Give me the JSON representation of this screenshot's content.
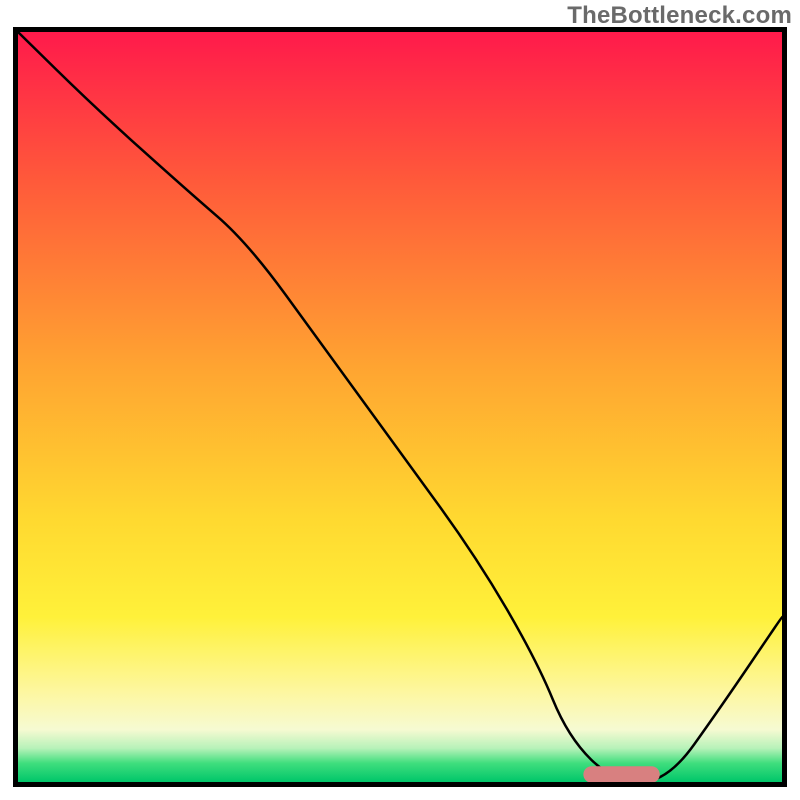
{
  "watermark": "TheBottleneck.com",
  "chart_data": {
    "type": "line",
    "title": "",
    "xlabel": "",
    "ylabel": "",
    "xlim": [
      0,
      100
    ],
    "ylim": [
      0,
      100
    ],
    "grid": false,
    "legend": false,
    "background": {
      "type": "vertical-gradient",
      "stops": [
        {
          "offset": 0.0,
          "color": "#ff1a4b"
        },
        {
          "offset": 0.2,
          "color": "#ff5a3a"
        },
        {
          "offset": 0.45,
          "color": "#ffa531"
        },
        {
          "offset": 0.65,
          "color": "#ffd930"
        },
        {
          "offset": 0.78,
          "color": "#fff13a"
        },
        {
          "offset": 0.88,
          "color": "#fdf7a0"
        },
        {
          "offset": 0.93,
          "color": "#f6fad2"
        },
        {
          "offset": 0.955,
          "color": "#b7f2b9"
        },
        {
          "offset": 0.975,
          "color": "#3fde7d"
        },
        {
          "offset": 1.0,
          "color": "#00c66a"
        }
      ]
    },
    "series": [
      {
        "name": "bottleneck-curve",
        "color": "#000000",
        "stroke_width": 2.5,
        "x": [
          0,
          10,
          22,
          30,
          40,
          50,
          60,
          68,
          72,
          78,
          85,
          92,
          100
        ],
        "y": [
          100,
          90,
          79,
          72,
          58,
          44,
          30,
          16,
          6,
          0,
          0,
          10,
          22
        ]
      }
    ],
    "marker": {
      "name": "optimal-range",
      "shape": "rounded-bar",
      "color": "#d88080",
      "x_start": 74,
      "x_end": 84,
      "y": 1.0,
      "height": 2.2
    },
    "border": {
      "color": "#000000",
      "width": 5
    }
  }
}
